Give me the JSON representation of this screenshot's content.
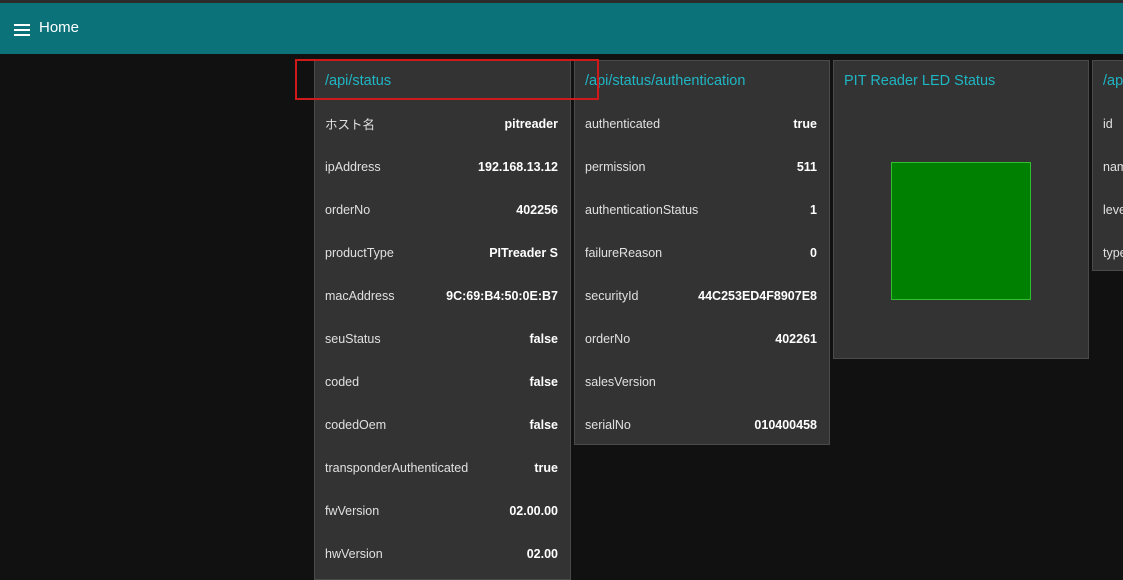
{
  "header": {
    "title": "Home"
  },
  "status_card": {
    "title": "/api/status",
    "rows": [
      {
        "key": "ホスト名",
        "value": "pitreader"
      },
      {
        "key": "ipAddress",
        "value": "192.168.13.12"
      },
      {
        "key": "orderNo",
        "value": "402256"
      },
      {
        "key": "productType",
        "value": "PITreader S"
      },
      {
        "key": "macAddress",
        "value": "9C:69:B4:50:0E:B7"
      },
      {
        "key": "seuStatus",
        "value": "false"
      },
      {
        "key": "coded",
        "value": "false"
      },
      {
        "key": "codedOem",
        "value": "false"
      },
      {
        "key": "transponderAuthenticated",
        "value": "true"
      },
      {
        "key": "fwVersion",
        "value": "02.00.00"
      },
      {
        "key": "hwVersion",
        "value": "02.00"
      }
    ]
  },
  "auth_card": {
    "title": "/api/status/authentication",
    "rows": [
      {
        "key": "authenticated",
        "value": "true"
      },
      {
        "key": "permission",
        "value": "511"
      },
      {
        "key": "authenticationStatus",
        "value": "1"
      },
      {
        "key": "failureReason",
        "value": "0"
      },
      {
        "key": "securityId",
        "value": "44C253ED4F8907E8"
      },
      {
        "key": "orderNo",
        "value": "402261"
      },
      {
        "key": "salesVersion",
        "value": ""
      },
      {
        "key": "serialNo",
        "value": "010400458"
      }
    ]
  },
  "led_card": {
    "title": "PIT Reader LED Status",
    "led_color": "#008000"
  },
  "partial_card": {
    "title": "/ap",
    "rows": [
      {
        "key": "id"
      },
      {
        "key": "nam"
      },
      {
        "key": "leve"
      },
      {
        "key": "type"
      }
    ]
  },
  "colors": {
    "header_bg": "#0b7279",
    "card_bg": "#333333",
    "title_accent": "#1fb6c4",
    "highlight_border": "#d01919"
  }
}
